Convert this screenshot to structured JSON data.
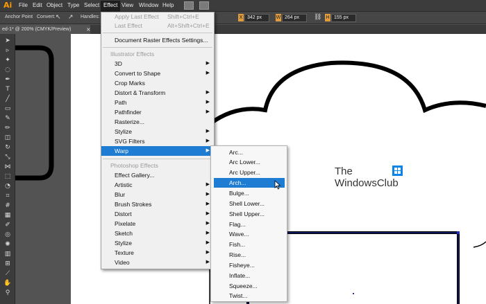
{
  "app": {
    "logo": "Ai"
  },
  "menubar": {
    "items": [
      "File",
      "Edit",
      "Object",
      "Type",
      "Select",
      "Effect",
      "View",
      "Window",
      "Help"
    ],
    "active": "Effect"
  },
  "control_bar": {
    "anchor_point_label": "Anchor Point",
    "convert_label": "Convert:",
    "handles_label": "Handles:",
    "x_value": "342 px",
    "w_value": "264 px",
    "h_value": "155 px"
  },
  "document": {
    "tab_title": "ed-1* @ 200% (CMYK/Preview)",
    "close": "×"
  },
  "effect_menu": {
    "apply_last": {
      "label": "Apply Last Effect",
      "shortcut": "Shift+Ctrl+E"
    },
    "last_effect": {
      "label": "Last Effect",
      "shortcut": "Alt+Shift+Ctrl+E"
    },
    "raster_settings": "Document Raster Effects Settings...",
    "illustrator_header": "Illustrator Effects",
    "illustrator_items": [
      "3D",
      "Convert to Shape",
      "Crop Marks",
      "Distort & Transform",
      "Path",
      "Pathfinder",
      "Rasterize...",
      "Stylize",
      "SVG Filters",
      "Warp"
    ],
    "photoshop_header": "Photoshop Effects",
    "photoshop_items": [
      "Effect Gallery...",
      "Artistic",
      "Blur",
      "Brush Strokes",
      "Distort",
      "Pixelate",
      "Sketch",
      "Stylize",
      "Texture",
      "Video"
    ],
    "selected": "Warp"
  },
  "warp_menu": {
    "items": [
      "Arc...",
      "Arc Lower...",
      "Arc Upper...",
      "Arch...",
      "Bulge...",
      "Shell Lower...",
      "Shell Upper...",
      "Flag...",
      "Wave...",
      "Fish...",
      "Rise...",
      "Fisheye...",
      "Inflate...",
      "Squeeze...",
      "Twist..."
    ],
    "selected": "Arch..."
  },
  "watermark": {
    "line1": "The",
    "line2": "WindowsClub"
  },
  "colors": {
    "accent": "#1e7cd2",
    "ai_orange": "#ff9a00"
  }
}
